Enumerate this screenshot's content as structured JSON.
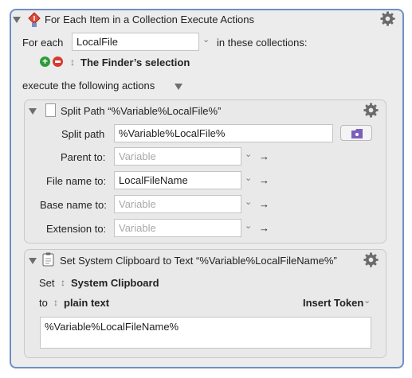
{
  "header": {
    "title": "For Each Item in a Collection Execute Actions"
  },
  "foreach": {
    "for_each_label": "For each",
    "variable_value": "LocalFile",
    "in_collections_label": "in these collections:",
    "collection": "The Finder’s selection",
    "execute_label": "execute the following actions"
  },
  "split": {
    "title": "Split Path “%Variable%LocalFile%”",
    "path_label": "Split path",
    "path_value": "%Variable%LocalFile%",
    "rows": [
      {
        "label": "Parent to:",
        "value": "",
        "placeholder": "Variable"
      },
      {
        "label": "File name to:",
        "value": "LocalFileName",
        "placeholder": ""
      },
      {
        "label": "Base name to:",
        "value": "",
        "placeholder": "Variable"
      },
      {
        "label": "Extension to:",
        "value": "",
        "placeholder": "Variable"
      }
    ]
  },
  "clipboard": {
    "title": "Set System Clipboard to Text “%Variable%LocalFileName%”",
    "set_label": "Set",
    "set_value": "System Clipboard",
    "to_label": "to",
    "to_value": "plain text",
    "insert_token": "Insert Token",
    "text": "%Variable%LocalFileName%"
  },
  "glyphs": {
    "chevron": "⌄",
    "arrow": "→",
    "updown": "↕"
  },
  "colors": {
    "border_accent": "#6f8fc6",
    "add_green": "#2e9a3a",
    "remove_red": "#d93a2f",
    "folder_purple": "#7b5fbf"
  }
}
